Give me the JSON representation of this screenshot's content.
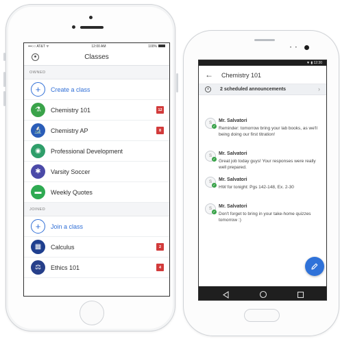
{
  "iphone": {
    "status": {
      "carrier": "•••○○ AT&T ᯤ",
      "time": "12:00 AM",
      "battery": "100%"
    },
    "nav": {
      "title": "Classes",
      "avatar_icon": "profile-icon"
    },
    "sections": [
      {
        "header": "OWNED",
        "rows": [
          {
            "label": "Create a class",
            "icon": "plus-icon",
            "color": "#2f6ed6",
            "badge": "",
            "is_action": true
          },
          {
            "label": "Chemistry 101",
            "icon": "flask-icon",
            "color": "#3aa34a",
            "badge": "12",
            "is_action": false
          },
          {
            "label": "Chemistry AP",
            "icon": "microscope-icon",
            "color": "#2a5db8",
            "badge": "8",
            "is_action": false
          },
          {
            "label": "Professional Development",
            "icon": "globe-icon",
            "color": "#2f9e6a",
            "badge": "",
            "is_action": false
          },
          {
            "label": "Varsity Soccer",
            "icon": "gear-icon",
            "color": "#4b4aa8",
            "badge": "",
            "is_action": false
          },
          {
            "label": "Weekly Quotes",
            "icon": "chat-icon",
            "color": "#2eaa52",
            "badge": "",
            "is_action": false
          }
        ]
      },
      {
        "header": "JOINED",
        "rows": [
          {
            "label": "Join a class",
            "icon": "plus-icon",
            "color": "#2f6ed6",
            "badge": "",
            "is_action": true
          },
          {
            "label": "Calculus",
            "icon": "calculator-icon",
            "color": "#1f3f8f",
            "badge": "2",
            "is_action": false
          },
          {
            "label": "Ethics 101",
            "icon": "scales-icon",
            "color": "#263f8a",
            "badge": "4",
            "is_action": false
          }
        ]
      }
    ]
  },
  "android": {
    "status": {
      "time": "▼ ▮ 12:30"
    },
    "toolbar": {
      "title": "Chemistry 101",
      "back_icon": "arrow-back-icon"
    },
    "scheduled": {
      "text": "2 scheduled announcements",
      "icon": "clock-icon",
      "chevron": "›"
    },
    "messages": [
      {
        "author": "Mr. Salvatori",
        "initial": "S",
        "body": "Reminder: tomorrow bring your lab books, as we'll being doing our first titration!"
      },
      {
        "author": "Mr. Salvatori",
        "initial": "S",
        "body": "Great job today guys! Your responses were really well prepared."
      },
      {
        "author": "Mr. Salvatori",
        "initial": "S",
        "body": "HW for tonight: Pgs 142-148, Ex. 2-30"
      },
      {
        "author": "Mr. Salvatori",
        "initial": "S",
        "body": "Don't forget to bring in your take-home quizzes tomorrow :)"
      }
    ],
    "fab_icon": "pencil-icon",
    "nav_icons": [
      "back-triangle-icon",
      "home-circle-icon",
      "recents-square-icon"
    ]
  },
  "colors": {
    "accent": "#2f6ed6",
    "badge": "#d23b3b",
    "fab": "#2f72d9",
    "check": "#3aa34a"
  }
}
